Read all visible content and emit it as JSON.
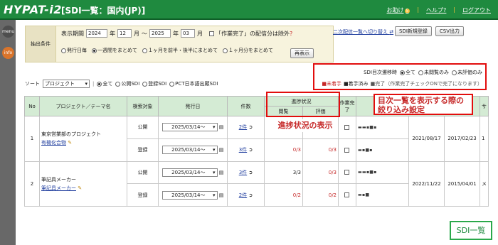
{
  "header": {
    "logo": "HYPAT-i2",
    "title": "[SDI一覧：国内(JP)]",
    "notice": "お助け",
    "notice_badge": "5",
    "help": "ヘルプ",
    "logout": "ログアウト"
  },
  "sidebar": {
    "menu": "menu",
    "info": "info"
  },
  "conditions": {
    "label": "抽出条件",
    "period_label": "表示期間",
    "from_year": "2024",
    "year_unit": "年",
    "from_month": "12",
    "month_unit": "月",
    "tilde": "～",
    "to_year": "2025",
    "to_month": "03",
    "exclude": "「作業完了」の配信分は除外",
    "options": [
      "発行日毎",
      "一週間をまとめて",
      "１ヶ月を前半・後半にまとめて",
      "１ヶ月分をまとめて"
    ],
    "redisplay": "再表示"
  },
  "toolbar": {
    "switch_link": "二次配信一覧へ切り替え",
    "new_sdi": "SDI新規登録",
    "csv": "CSV出力"
  },
  "sort": {
    "label": "ソート",
    "value": "プロジェクト",
    "options": [
      "全て",
      "公開SDI",
      "登録SDI",
      "PCT日本語出願SDI"
    ]
  },
  "filter": {
    "label": "SDI目次遷移時",
    "options": [
      "全て",
      "未閲覧のみ",
      "未評価のみ"
    ],
    "legend": [
      "■未着手",
      "■着手済み",
      "■完了（作業完了チェックONで完了になります）"
    ]
  },
  "table": {
    "headers": {
      "no": "No",
      "project": "プロジェクト／テーマ名",
      "target": "検索対象",
      "date": "発行日",
      "count": "件数",
      "progress": "進捗状況",
      "viewed": "閲覧",
      "evaluated": "評価",
      "done": "作業完了",
      "col_s": "サ"
    },
    "rows": [
      {
        "no": "1",
        "project": "東京営業部のプロジェクト",
        "theme": "有機化合物",
        "sub": [
          {
            "target": "公開",
            "date": "2025/03/14～",
            "count": "2件",
            "viewed": "0/3",
            "evaluated": "0/3"
          },
          {
            "target": "登録",
            "date": "2025/03/14～",
            "count": "3件",
            "viewed": "0/3",
            "evaluated": "0/3"
          }
        ],
        "date1": "2021/08/17",
        "date2": "2017/02/23",
        "extra": "1"
      },
      {
        "no": "2",
        "project": "筆記具メーカー",
        "theme": "筆記具メーカー",
        "sub": [
          {
            "target": "公開",
            "date": "2025/03/14～",
            "count": "3件",
            "viewed": "3/3",
            "evaluated": "0/3"
          },
          {
            "target": "登録",
            "date": "2025/03/14～",
            "count": "2件",
            "viewed": "0/2",
            "evaluated": "0/2"
          }
        ],
        "date1": "2022/11/22",
        "date2": "2015/04/01",
        "extra": "メ"
      }
    ]
  },
  "callouts": {
    "progress": "進捗状況の表示",
    "filter_line1": "目次一覧を表示する際の",
    "filter_line2": "絞り込み設定"
  },
  "page_label": "SDI一覧",
  "colors": {
    "header": "#1f8a3f",
    "accent_red": "#e20d0d",
    "table_header": "#d4ebd4"
  }
}
